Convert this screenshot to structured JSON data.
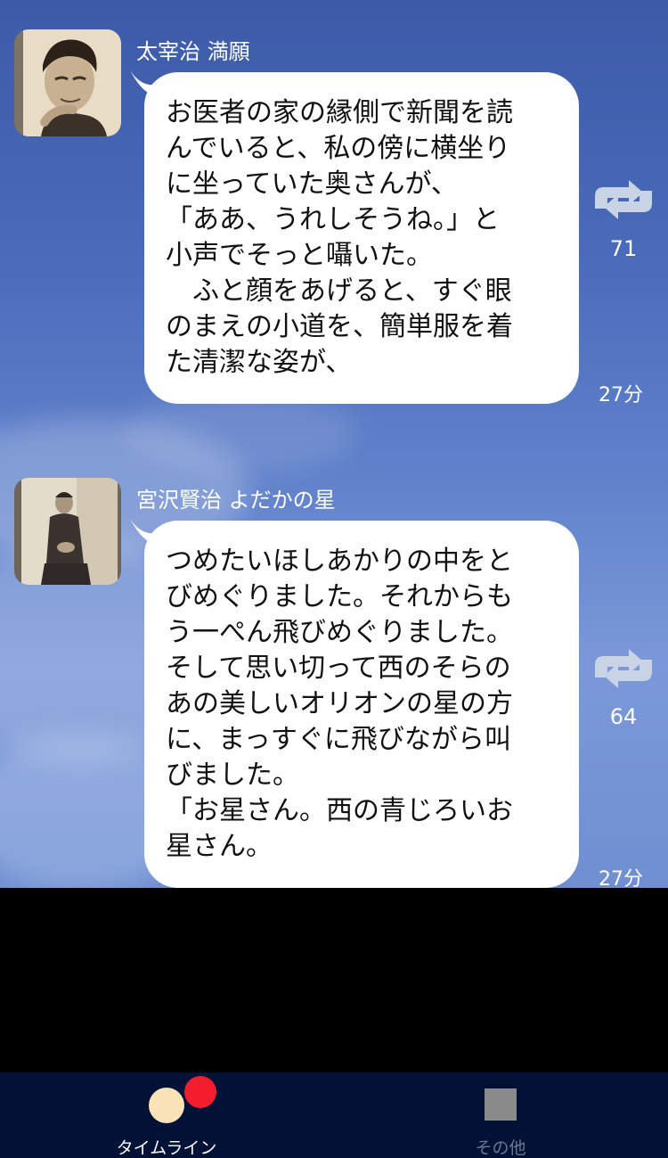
{
  "posts": [
    {
      "author": "太宰治 満願",
      "body": "お医者の家の縁側で新聞を読\nんでいると、私の傍に横坐り\nに坐っていた奥さんが、\n「ああ、うれしそうね。」と\n小声でそっと囁いた。\n　ふと顔をあげると、すぐ眼\nのまえの小道を、簡単服を着\nた清潔な姿が、",
      "repost_count": "71",
      "time": "27分",
      "avatar_icon": "portrait-dazai"
    },
    {
      "author": "宮沢賢治 よだかの星",
      "body": "つめたいほしあかりの中をと\nびめぐりました。それからも\nう一ぺん飛びめぐりました。\nそして思い切って西のそらの\nあの美しいオリオンの星の方\nに、まっすぐに飛びながら叫\nびました。\n「お星さん。西の青じろいお\n星さん。",
      "repost_count": "64",
      "time": "27分",
      "avatar_icon": "portrait-miyazawa"
    }
  ],
  "tabbar": {
    "timeline_label": "タイムライン",
    "other_label": "その他"
  },
  "colors": {
    "tabbar_bg": "#021237",
    "badge_red": "#f31d2e",
    "cream": "#fbe3b8",
    "repost_icon": "#c9d3e6"
  }
}
